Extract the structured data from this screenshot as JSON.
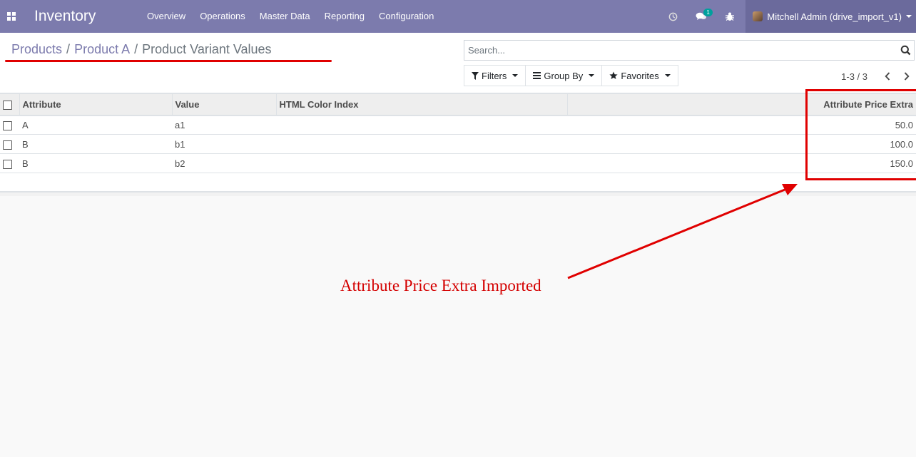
{
  "navbar": {
    "brand": "Inventory",
    "menu": [
      "Overview",
      "Operations",
      "Master Data",
      "Reporting",
      "Configuration"
    ],
    "messages_badge": "1",
    "user": "Mitchell Admin (drive_import_v1)"
  },
  "breadcrumb": {
    "items": [
      "Products",
      "Product A"
    ],
    "separator": "/",
    "current": "Product Variant Values"
  },
  "search": {
    "placeholder": "Search..."
  },
  "filters": {
    "filters_label": "Filters",
    "group_by_label": "Group By",
    "favorites_label": "Favorites"
  },
  "pager": {
    "value": "1-3 / 3"
  },
  "table": {
    "columns": [
      "Attribute",
      "Value",
      "HTML Color Index",
      "",
      "Attribute Price Extra"
    ],
    "rows": [
      {
        "attribute": "A",
        "value": "a1",
        "color_index": "",
        "price_extra": "50.0"
      },
      {
        "attribute": "B",
        "value": "b1",
        "color_index": "",
        "price_extra": "100.0"
      },
      {
        "attribute": "B",
        "value": "b2",
        "color_index": "",
        "price_extra": "150.0"
      }
    ]
  },
  "annotation": {
    "text": "Attribute Price Extra Imported",
    "color": "#e00000"
  },
  "colors": {
    "navbar": "#7c7bad",
    "link": "#7c7bad"
  }
}
